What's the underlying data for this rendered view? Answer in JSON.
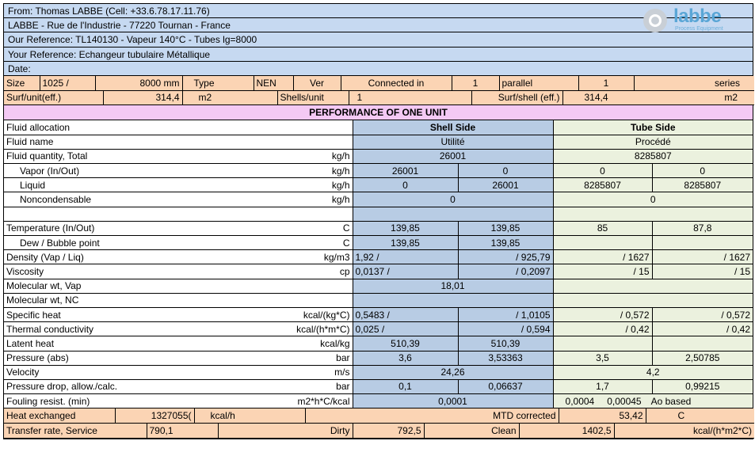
{
  "header": {
    "from": "From: Thomas LABBE (Cell: +33.6.78.17.11.76)",
    "address": "LABBE - Rue de l'Industrie - 77220 Tournan - France",
    "our_ref": "Our Reference: TL140130 - Vapeur 140°C - Tubes lg=8000",
    "your_ref": "Your Reference: Echangeur tubulaire Métallique",
    "date": "Date:"
  },
  "logo": {
    "name": "labbe",
    "tagline": "Process Equipment"
  },
  "size_row": {
    "size_label": "Size",
    "size_val": "1025  /",
    "length": "8000 mm",
    "type_label": "Type",
    "type_val": "NEN",
    "ver_label": "Ver",
    "conn_label": "Connected in",
    "parallel_n": "1",
    "parallel_label": "parallel",
    "series_n": "1",
    "series_label": "series"
  },
  "surf_row": {
    "label": "Surf/unit(eff.)",
    "value": "314,4",
    "unit": "m2",
    "shells_label": "Shells/unit",
    "shells_val": "1",
    "surfshell_label": "Surf/shell (eff.)",
    "surfshell_val": "314,4",
    "surfshell_unit": "m2"
  },
  "performance_title": "PERFORMANCE OF ONE UNIT",
  "rows": {
    "alloc": {
      "label": "Fluid allocation",
      "shell": "Shell Side",
      "tube": "Tube Side"
    },
    "name": {
      "label": "Fluid name",
      "shell": "Utilité",
      "tube": "Procédé"
    },
    "qty": {
      "label": "Fluid quantity, Total",
      "unit": "kg/h",
      "shell": "26001",
      "tube": "8285807"
    },
    "vapor": {
      "label": "Vapor (In/Out)",
      "unit": "kg/h",
      "s_in": "26001",
      "s_out": "0",
      "t_in": "0",
      "t_out": "0"
    },
    "liquid": {
      "label": "Liquid",
      "unit": "kg/h",
      "s_in": "0",
      "s_out": "26001",
      "t_in": "8285807",
      "t_out": "8285807"
    },
    "noncond": {
      "label": "Noncondensable",
      "unit": "kg/h",
      "shell": "0",
      "tube": "0"
    },
    "temp": {
      "label": "Temperature (In/Out)",
      "unit": "C",
      "s_in": "139,85",
      "s_out": "139,85",
      "t_in": "85",
      "t_out": "87,8"
    },
    "dew": {
      "label": "Dew / Bubble point",
      "unit": "C",
      "s_in": "139,85",
      "s_out": "139,85"
    },
    "density": {
      "label": "Density (Vap / Liq)",
      "unit": "kg/m3",
      "s_in": "1,92   /",
      "s_out": "/ 925,79",
      "t_in": "/       1627",
      "t_out": "/       1627"
    },
    "visc": {
      "label": "Viscosity",
      "unit": "cp",
      "s_in": "0,0137   /",
      "s_out": "/ 0,2097",
      "t_in": "/       15",
      "t_out": "/       15"
    },
    "molvap": {
      "label": "Molecular wt, Vap",
      "shell": "18,01"
    },
    "molnc": {
      "label": "Molecular wt, NC"
    },
    "spheat": {
      "label": "Specific heat",
      "unit": "kcal/(kg*C)",
      "s_in": "0,5483   /",
      "s_out": "/ 1,0105",
      "t_in": "/     0,572",
      "t_out": "/     0,572"
    },
    "thcond": {
      "label": "Thermal conductivity",
      "unit": "kcal/(h*m*C)",
      "s_in": "0,025   /",
      "s_out": "/ 0,594",
      "t_in": "/     0,42",
      "t_out": "/     0,42"
    },
    "latent": {
      "label": "Latent heat",
      "unit": "kcal/kg",
      "s_in": "510,39",
      "s_out": "510,39"
    },
    "press": {
      "label": "Pressure (abs)",
      "unit": "bar",
      "s_in": "3,6",
      "s_out": "3,53363",
      "t_in": "3,5",
      "t_out": "2,50785"
    },
    "vel": {
      "label": "Velocity",
      "unit": "m/s",
      "shell": "24,26",
      "tube": "4,2"
    },
    "pdrop": {
      "label": "Pressure drop, allow./calc.",
      "unit": "bar",
      "s_in": "0,1",
      "s_out": "0,06637",
      "t_in": "1,7",
      "t_out": "0,99215"
    },
    "foul": {
      "label": "Fouling resist. (min)",
      "unit": "m2*h*C/kcal",
      "shell": "0,0001",
      "t1": "0,0004",
      "t2": "0,00045",
      "t3": "Ao based"
    }
  },
  "heat_row": {
    "label": "Heat exchanged",
    "value": "1327055(",
    "unit": "kcal/h",
    "mtd_label": "MTD corrected",
    "mtd_val": "53,42",
    "mtd_unit": "C"
  },
  "transfer_row": {
    "label": "Transfer rate, Service",
    "value": "790,1",
    "dirty_label": "Dirty",
    "dirty_val": "792,5",
    "clean_label": "Clean",
    "clean_val": "1402,5",
    "unit": "kcal/(h*m2*C)"
  }
}
